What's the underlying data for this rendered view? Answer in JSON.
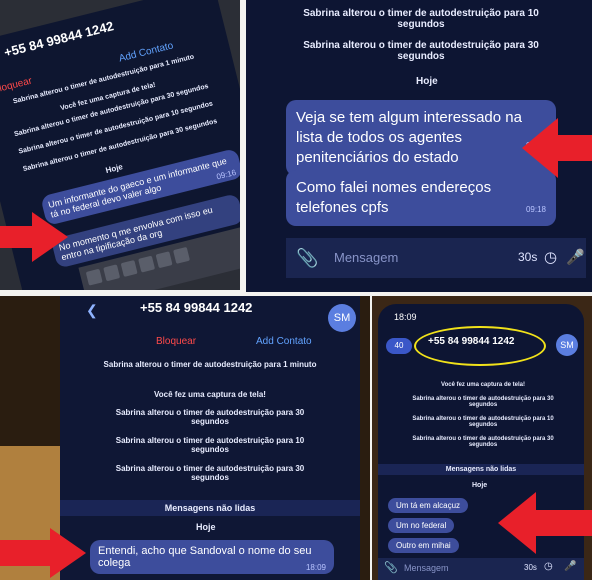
{
  "top_left": {
    "contact": "+55 84 99844 1242",
    "block": "Bloquear",
    "add": "Add Contato",
    "sys_lines": [
      "Sabrina alterou o timer de autodestruição para 1 minuto",
      "Você fez uma captura de tela!",
      "Sabrina alterou o timer de autodestruição para 30 segundos",
      "Sabrina alterou o timer de autodestruição para 10 segundos",
      "Sabrina alterou o timer de autodestruição para 30 segundos"
    ],
    "hoje": "Hoje",
    "msg1": "Um informante do gaeco e um informante que tá no federal devo valer algo",
    "msg1_time": "09:16",
    "msg2": "No momento q me envolva com isso eu entro na tipificação da org"
  },
  "top_right": {
    "sys1": "Sabrina alterou o timer de autodestruição para 10 segundos",
    "sys2": "Sabrina alterou o timer de autodestruição para 30 segundos",
    "hoje": "Hoje",
    "msg1": "Veja se tem algum interessado na lista de todos os agentes penitenciários do estado",
    "msg1_time": "09:18",
    "msg2": "Como falei nomes endereços telefones cpfs",
    "msg2_time": "09:18",
    "input_placeholder": "Mensagem",
    "timer": "30s"
  },
  "bottom_left": {
    "contact": "+55 84 99844 1242",
    "avatar": "SM",
    "block": "Bloquear",
    "add": "Add Contato",
    "sys_lines": [
      "Sabrina alterou o timer de autodestruição para 1 minuto",
      "Você fez uma captura de tela!",
      "Sabrina alterou o timer de autodestruição para 30 segundos",
      "Sabrina alterou o timer de autodestruição para 10 segundos",
      "Sabrina alterou o timer de autodestruição para 30 segundos"
    ],
    "unread": "Mensagens não lidas",
    "hoje": "Hoje",
    "msg": "Entendi, acho que Sandoval o nome do seu colega",
    "msg_time": "18:09"
  },
  "bottom_right": {
    "clock": "18:09",
    "contact": "+55 84 99844 1242",
    "avatar": "SM",
    "back": "40",
    "sys_lines": [
      "Você fez uma captura de tela!",
      "Sabrina alterou o timer de autodestruição para 30 segundos",
      "Sabrina alterou o timer de autodestruição para 10 segundos",
      "Sabrina alterou o timer de autodestruição para 30 segundos"
    ],
    "unread": "Mensagens não lidas",
    "hoje": "Hoje",
    "msg1": "Um tá em alcaçuz",
    "msg2": "Um no federal",
    "msg3": "Outro em mihai",
    "input_placeholder": "Mensagem",
    "timer": "30s"
  },
  "colors": {
    "arrow": "#e8202a",
    "bubble": "#3d4d9c",
    "screen": "#0e1630",
    "highlight": "#f1e21a"
  }
}
